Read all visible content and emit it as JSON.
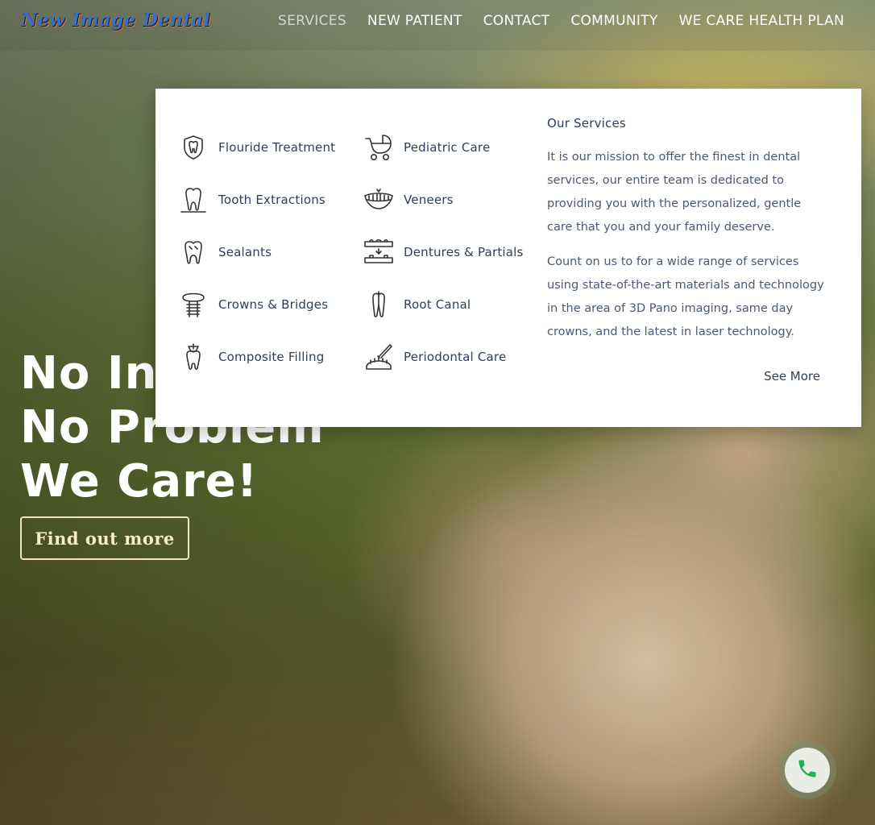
{
  "brand": {
    "logo_text": "New Image Dental"
  },
  "nav": {
    "items": [
      {
        "label": "SERVICES"
      },
      {
        "label": "NEW PATIENT"
      },
      {
        "label": "CONTACT"
      },
      {
        "label": "COMMUNITY"
      },
      {
        "label": "WE CARE HEALTH PLAN"
      }
    ]
  },
  "hero": {
    "lines": [
      "No Ins",
      "No Problem",
      "We Care!"
    ],
    "cta_label": "Find out more"
  },
  "services_menu": {
    "column1": [
      {
        "label": "Flouride Treatment",
        "icon": "shield-tooth-icon"
      },
      {
        "label": "Tooth Extractions",
        "icon": "tooth-icon"
      },
      {
        "label": "Sealants",
        "icon": "tooth-icon"
      },
      {
        "label": "Crowns & Bridges",
        "icon": "implant-icon"
      },
      {
        "label": "Composite Filling",
        "icon": "filling-tooth-icon"
      }
    ],
    "column2": [
      {
        "label": "Pediatric Care",
        "icon": "baby-carriage-icon"
      },
      {
        "label": "Veneers",
        "icon": "smile-teeth-icon"
      },
      {
        "label": "Dentures & Partials",
        "icon": "dentures-icon"
      },
      {
        "label": "Root Canal",
        "icon": "root-canal-icon"
      },
      {
        "label": "Periodontal Care",
        "icon": "dental-tool-icon"
      }
    ],
    "about": {
      "heading": "Our Services",
      "paragraph1": "It is our mission to offer the finest in dental services, our entire team is dedicated to providing you with the personalized, gentle care that you and your family deserve.",
      "paragraph2": "Count on us to for a wide range of services using state-of-the-art materials and technology in the area of 3D Pano imaging, same day crowns, and the latest in laser technology.",
      "see_more": "See More"
    }
  },
  "phone": {
    "icon": "phone-icon",
    "color": "#22b14c"
  }
}
